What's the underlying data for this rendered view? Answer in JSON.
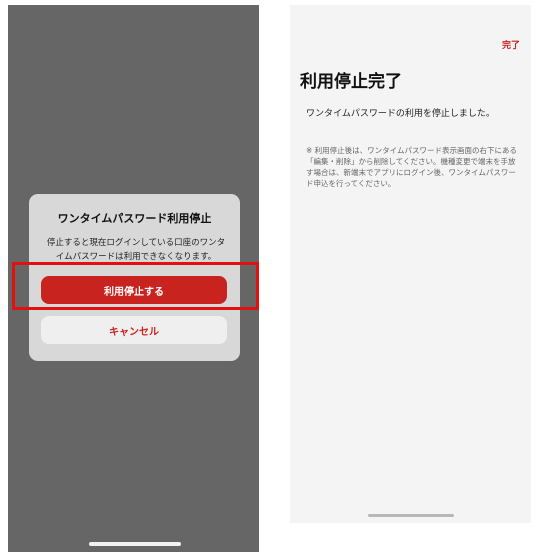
{
  "left_screen": {
    "dialog": {
      "title": "ワンタイムパスワード利用停止",
      "message": "停止すると現在ログインしている口座のワンタイムパスワードは利用できなくなります。",
      "primary_button": "利用停止する",
      "cancel_button": "キャンセル"
    }
  },
  "right_screen": {
    "done_label": "完了",
    "title": "利用停止完了",
    "main_message": "ワンタイムパスワードの利用を停止しました。",
    "note": "※ 利用停止後は、ワンタイムパスワード表示画面の右下にある「編集・削除」から削除してください。機種変更で端末を手放す場合は、新端末でアプリにログイン後、ワンタイムパスワード申込を行ってください。"
  },
  "colors": {
    "accent": "#c9231f",
    "highlight": "#e31010",
    "overlay": "#666666"
  }
}
